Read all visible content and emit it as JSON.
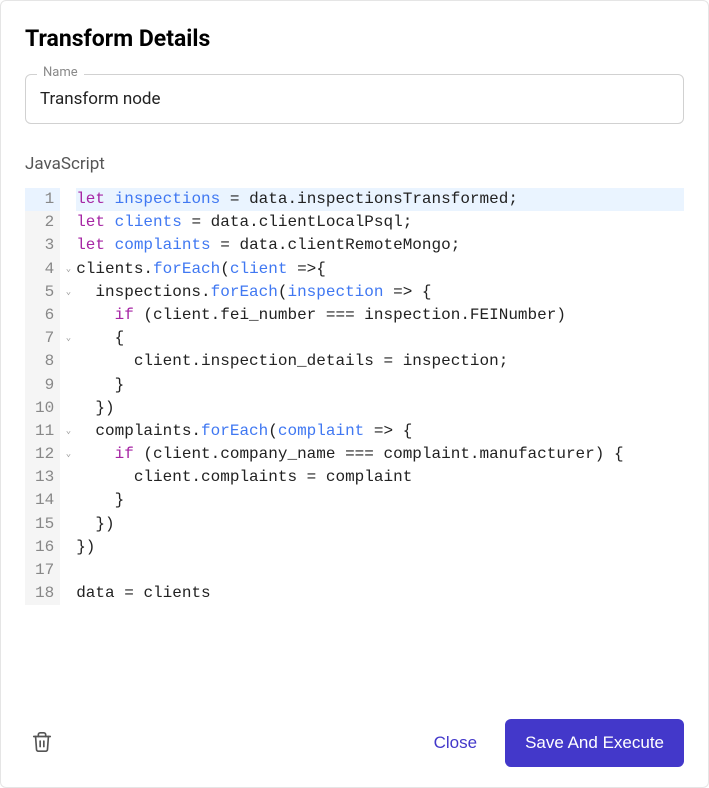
{
  "title": "Transform Details",
  "name_field": {
    "label": "Name",
    "value": "Transform node"
  },
  "code_section_label": "JavaScript",
  "code": {
    "lines": [
      {
        "n": 1,
        "highlighted": true,
        "fold": false,
        "tokens": [
          [
            "keyword",
            "let"
          ],
          [
            "space",
            " "
          ],
          [
            "var",
            "inspections"
          ],
          [
            "space",
            " "
          ],
          [
            "punct",
            "="
          ],
          [
            "space",
            " "
          ],
          [
            "prop",
            "data"
          ],
          [
            "punct",
            "."
          ],
          [
            "prop",
            "inspectionsTransformed"
          ],
          [
            "punct",
            ";"
          ]
        ]
      },
      {
        "n": 2,
        "highlighted": false,
        "fold": false,
        "tokens": [
          [
            "keyword",
            "let"
          ],
          [
            "space",
            " "
          ],
          [
            "var",
            "clients"
          ],
          [
            "space",
            " "
          ],
          [
            "punct",
            "="
          ],
          [
            "space",
            " "
          ],
          [
            "prop",
            "data"
          ],
          [
            "punct",
            "."
          ],
          [
            "prop",
            "clientLocalPsql"
          ],
          [
            "punct",
            ";"
          ]
        ]
      },
      {
        "n": 3,
        "highlighted": false,
        "fold": false,
        "tokens": [
          [
            "keyword",
            "let"
          ],
          [
            "space",
            " "
          ],
          [
            "var",
            "complaints"
          ],
          [
            "space",
            " "
          ],
          [
            "punct",
            "="
          ],
          [
            "space",
            " "
          ],
          [
            "prop",
            "data"
          ],
          [
            "punct",
            "."
          ],
          [
            "prop",
            "clientRemoteMongo"
          ],
          [
            "punct",
            ";"
          ]
        ]
      },
      {
        "n": 4,
        "highlighted": false,
        "fold": true,
        "tokens": [
          [
            "prop",
            "clients"
          ],
          [
            "punct",
            "."
          ],
          [
            "var",
            "forEach"
          ],
          [
            "punct",
            "("
          ],
          [
            "var",
            "client"
          ],
          [
            "space",
            " "
          ],
          [
            "punct",
            "=>"
          ],
          [
            "punct",
            "{"
          ]
        ]
      },
      {
        "n": 5,
        "highlighted": false,
        "fold": true,
        "tokens": [
          [
            "space",
            "  "
          ],
          [
            "prop",
            "inspections"
          ],
          [
            "punct",
            "."
          ],
          [
            "var",
            "forEach"
          ],
          [
            "punct",
            "("
          ],
          [
            "var",
            "inspection"
          ],
          [
            "space",
            " "
          ],
          [
            "punct",
            "=>"
          ],
          [
            "space",
            " "
          ],
          [
            "punct",
            "{"
          ]
        ]
      },
      {
        "n": 6,
        "highlighted": false,
        "fold": false,
        "tokens": [
          [
            "space",
            "    "
          ],
          [
            "keyword",
            "if"
          ],
          [
            "space",
            " "
          ],
          [
            "punct",
            "("
          ],
          [
            "prop",
            "client"
          ],
          [
            "punct",
            "."
          ],
          [
            "prop",
            "fei_number"
          ],
          [
            "space",
            " "
          ],
          [
            "punct",
            "==="
          ],
          [
            "space",
            " "
          ],
          [
            "prop",
            "inspection"
          ],
          [
            "punct",
            "."
          ],
          [
            "prop",
            "FEINumber"
          ],
          [
            "punct",
            ")"
          ]
        ]
      },
      {
        "n": 7,
        "highlighted": false,
        "fold": true,
        "tokens": [
          [
            "space",
            "    "
          ],
          [
            "punct",
            "{"
          ]
        ]
      },
      {
        "n": 8,
        "highlighted": false,
        "fold": false,
        "tokens": [
          [
            "space",
            "      "
          ],
          [
            "prop",
            "client"
          ],
          [
            "punct",
            "."
          ],
          [
            "prop",
            "inspection_details"
          ],
          [
            "space",
            " "
          ],
          [
            "punct",
            "="
          ],
          [
            "space",
            " "
          ],
          [
            "prop",
            "inspection"
          ],
          [
            "punct",
            ";"
          ]
        ]
      },
      {
        "n": 9,
        "highlighted": false,
        "fold": false,
        "tokens": [
          [
            "space",
            "    "
          ],
          [
            "punct",
            "}"
          ]
        ]
      },
      {
        "n": 10,
        "highlighted": false,
        "fold": false,
        "tokens": [
          [
            "space",
            "  "
          ],
          [
            "punct",
            "})"
          ]
        ]
      },
      {
        "n": 11,
        "highlighted": false,
        "fold": true,
        "tokens": [
          [
            "space",
            "  "
          ],
          [
            "prop",
            "complaints"
          ],
          [
            "punct",
            "."
          ],
          [
            "var",
            "forEach"
          ],
          [
            "punct",
            "("
          ],
          [
            "var",
            "complaint"
          ],
          [
            "space",
            " "
          ],
          [
            "punct",
            "=>"
          ],
          [
            "space",
            " "
          ],
          [
            "punct",
            "{"
          ]
        ]
      },
      {
        "n": 12,
        "highlighted": false,
        "fold": true,
        "tokens": [
          [
            "space",
            "    "
          ],
          [
            "keyword",
            "if"
          ],
          [
            "space",
            " "
          ],
          [
            "punct",
            "("
          ],
          [
            "prop",
            "client"
          ],
          [
            "punct",
            "."
          ],
          [
            "prop",
            "company_name"
          ],
          [
            "space",
            " "
          ],
          [
            "punct",
            "==="
          ],
          [
            "space",
            " "
          ],
          [
            "prop",
            "complaint"
          ],
          [
            "punct",
            "."
          ],
          [
            "prop",
            "manufacturer"
          ],
          [
            "punct",
            ")"
          ],
          [
            "space",
            " "
          ],
          [
            "punct",
            "{"
          ]
        ]
      },
      {
        "n": 13,
        "highlighted": false,
        "fold": false,
        "tokens": [
          [
            "space",
            "      "
          ],
          [
            "prop",
            "client"
          ],
          [
            "punct",
            "."
          ],
          [
            "prop",
            "complaints"
          ],
          [
            "space",
            " "
          ],
          [
            "punct",
            "="
          ],
          [
            "space",
            " "
          ],
          [
            "prop",
            "complaint"
          ]
        ]
      },
      {
        "n": 14,
        "highlighted": false,
        "fold": false,
        "tokens": [
          [
            "space",
            "    "
          ],
          [
            "punct",
            "}"
          ]
        ]
      },
      {
        "n": 15,
        "highlighted": false,
        "fold": false,
        "tokens": [
          [
            "space",
            "  "
          ],
          [
            "punct",
            "})"
          ]
        ]
      },
      {
        "n": 16,
        "highlighted": false,
        "fold": false,
        "tokens": [
          [
            "punct",
            "})"
          ]
        ]
      },
      {
        "n": 17,
        "highlighted": false,
        "fold": false,
        "tokens": [
          [
            "space",
            ""
          ]
        ]
      },
      {
        "n": 18,
        "highlighted": false,
        "fold": false,
        "tokens": [
          [
            "prop",
            "data"
          ],
          [
            "space",
            " "
          ],
          [
            "punct",
            "="
          ],
          [
            "space",
            " "
          ],
          [
            "prop",
            "clients"
          ]
        ]
      }
    ]
  },
  "footer": {
    "close_label": "Close",
    "save_label": "Save And Execute"
  }
}
